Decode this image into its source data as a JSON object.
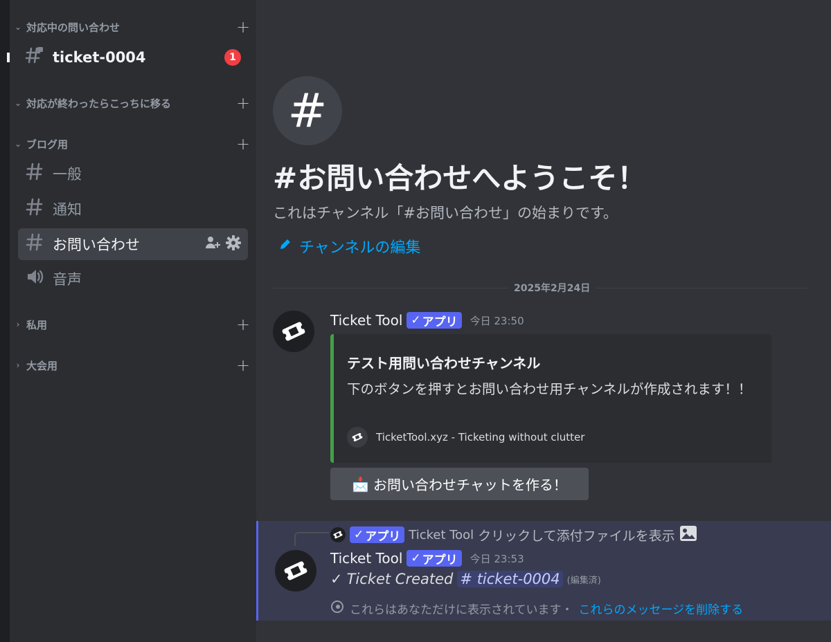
{
  "colors": {
    "bg_main": "#313338",
    "bg_sidebar": "#2b2d31",
    "accent_blurple": "#5865f2",
    "link_blue": "#00a8fc",
    "embed_bar": "#43a047",
    "badge_red": "#f23f43"
  },
  "sidebar": {
    "categories": [
      {
        "label": "対応中の問い合わせ",
        "add_icon": "plus-icon"
      },
      {
        "label": "対応が終わったらこっちに移る",
        "add_icon": "plus-icon"
      },
      {
        "label": "ブログ用",
        "add_icon": "plus-icon"
      },
      {
        "label": "私用",
        "add_icon": "plus-icon"
      },
      {
        "label": "大会用",
        "add_icon": "plus-icon"
      }
    ],
    "channels": [
      {
        "name": "ticket-0004",
        "icon": "locked-hash-icon",
        "badge": "1"
      },
      {
        "name": "一般",
        "icon": "hash-icon"
      },
      {
        "name": "通知",
        "icon": "hash-icon"
      },
      {
        "name": "お問い合わせ",
        "icon": "hash-icon",
        "actions": [
          "invite-icon",
          "gear-icon"
        ]
      },
      {
        "name": "音声",
        "icon": "speaker-icon"
      }
    ]
  },
  "main": {
    "welcome_symbol": "#",
    "welcome_title": "#お問い合わせへようこそ！",
    "welcome_subtitle": "これはチャンネル「#お問い合わせ」の始まりです。",
    "edit_channel_label": "チャンネルの編集",
    "date_divider": "2025年2月24日"
  },
  "messages": [
    {
      "author": "Ticket Tool",
      "app_tag": "アプリ",
      "timestamp": "今日 23:50",
      "embed": {
        "title": "テスト用問い合わせチャンネル",
        "description": "下のボタンを押すとお問い合わせ用チャンネルが作成されます！！",
        "footer": "TicketTool.xyz - Ticketing without clutter"
      },
      "button": {
        "emoji": "📩",
        "label": "お問い合わせチャットを作る！"
      }
    },
    {
      "reply": {
        "app_tag": "アプリ",
        "author": "Ticket Tool",
        "text": "クリックして添付ファイルを表示"
      },
      "author": "Ticket Tool",
      "app_tag": "アプリ",
      "timestamp": "今日 23:53",
      "check": "✓",
      "content": "Ticket Created",
      "mention_hash": "#",
      "mention": "ticket-0004",
      "edited": "(編集済)",
      "ephemeral_note": "これらはあなただけに表示されています・",
      "dismiss_link": "これらのメッセージを削除する"
    }
  ]
}
